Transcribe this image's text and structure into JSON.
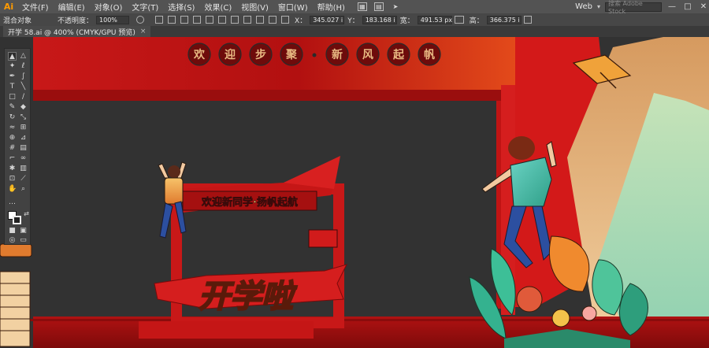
{
  "app": {
    "logo": "Ai"
  },
  "menu": [
    "文件(F)",
    "编辑(E)",
    "对象(O)",
    "文字(T)",
    "选择(S)",
    "效果(C)",
    "视图(V)",
    "窗口(W)",
    "帮助(H)"
  ],
  "workspace": {
    "label": "Web",
    "search_placeholder": "搜索 Adobe Stock"
  },
  "window_controls": [
    "—",
    "□",
    "✕"
  ],
  "control_bar": {
    "selection": "混合对象",
    "opacity_label": "不透明度：",
    "opacity_value": "100%",
    "x_label": "X：",
    "x_value": "345.027 i",
    "y_label": "Y：",
    "y_value": "183.168 i",
    "w_label": "宽：",
    "w_value": "491.53 px",
    "h_label": "高：",
    "h_value": "366.375 i"
  },
  "document_tab": {
    "title": "开学 58.ai @ 400% (CMYK/GPU 预览)",
    "close": "×"
  },
  "artwork": {
    "top_circles": [
      "欢",
      "迎",
      "步",
      "聚",
      "新",
      "风",
      "起",
      "帆"
    ],
    "banner_text": "欢迎新同学·扬帆起航",
    "big_text": "开学啦",
    "colors": {
      "red": "#d51e1e",
      "dark_red": "#8e0d0d",
      "orange": "#f0a040",
      "teal": "#3ab89a",
      "beige": "#e8b982",
      "mint": "#b9dbb1"
    }
  },
  "tools": [
    "selection-tool",
    "direct-selection-tool",
    "magic-wand-tool",
    "lasso-tool",
    "pen-tool",
    "curvature-tool",
    "type-tool",
    "line-tool",
    "rectangle-tool",
    "paintbrush-tool",
    "shaper-tool",
    "eraser-tool",
    "rotate-tool",
    "scale-tool",
    "width-tool",
    "free-transform-tool",
    "shape-builder-tool",
    "perspective-tool",
    "mesh-tool",
    "gradient-tool",
    "eyedropper-tool",
    "blend-tool",
    "symbol-sprayer-tool",
    "column-graph-tool",
    "artboard-tool",
    "slice-tool",
    "hand-tool",
    "zoom-tool",
    "fill-swatch",
    "stroke-swatch",
    "swap-colors",
    "color-mode",
    "draw-mode",
    "screen-mode"
  ]
}
